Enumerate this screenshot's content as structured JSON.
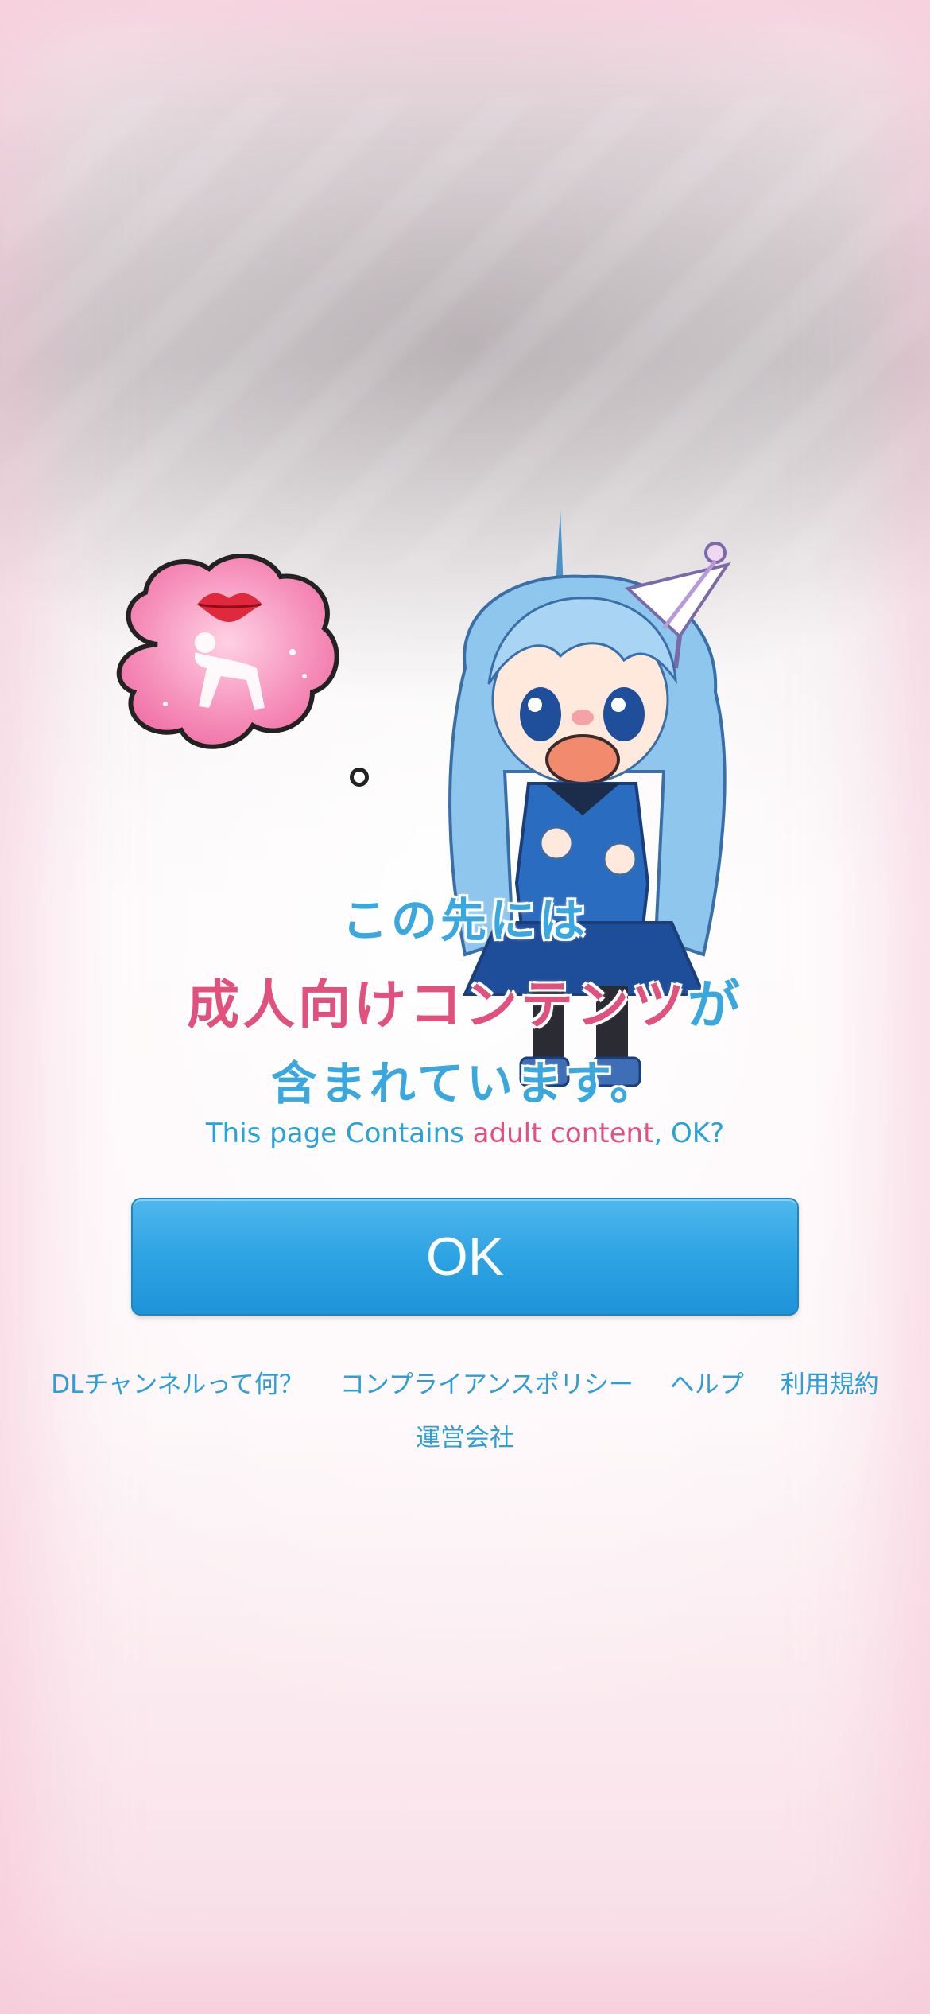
{
  "headline": {
    "line1": "この先には",
    "line2_pink": "成人向けコンテンツ",
    "line2_blue": "が",
    "line3": "含まれています。",
    "subline_a": "This page Contains ",
    "subline_b": "adult content",
    "subline_c": ", OK?"
  },
  "ok_button": {
    "label": "OK"
  },
  "footer": {
    "links": [
      "DLチャンネルって何？",
      "コンプライアンスポリシー",
      "ヘルプ",
      "利用規約",
      "運営会社"
    ]
  },
  "colors": {
    "accent_blue": "#2ea3e3",
    "accent_pink": "#e2507e",
    "link_blue": "#2d9fd6"
  }
}
